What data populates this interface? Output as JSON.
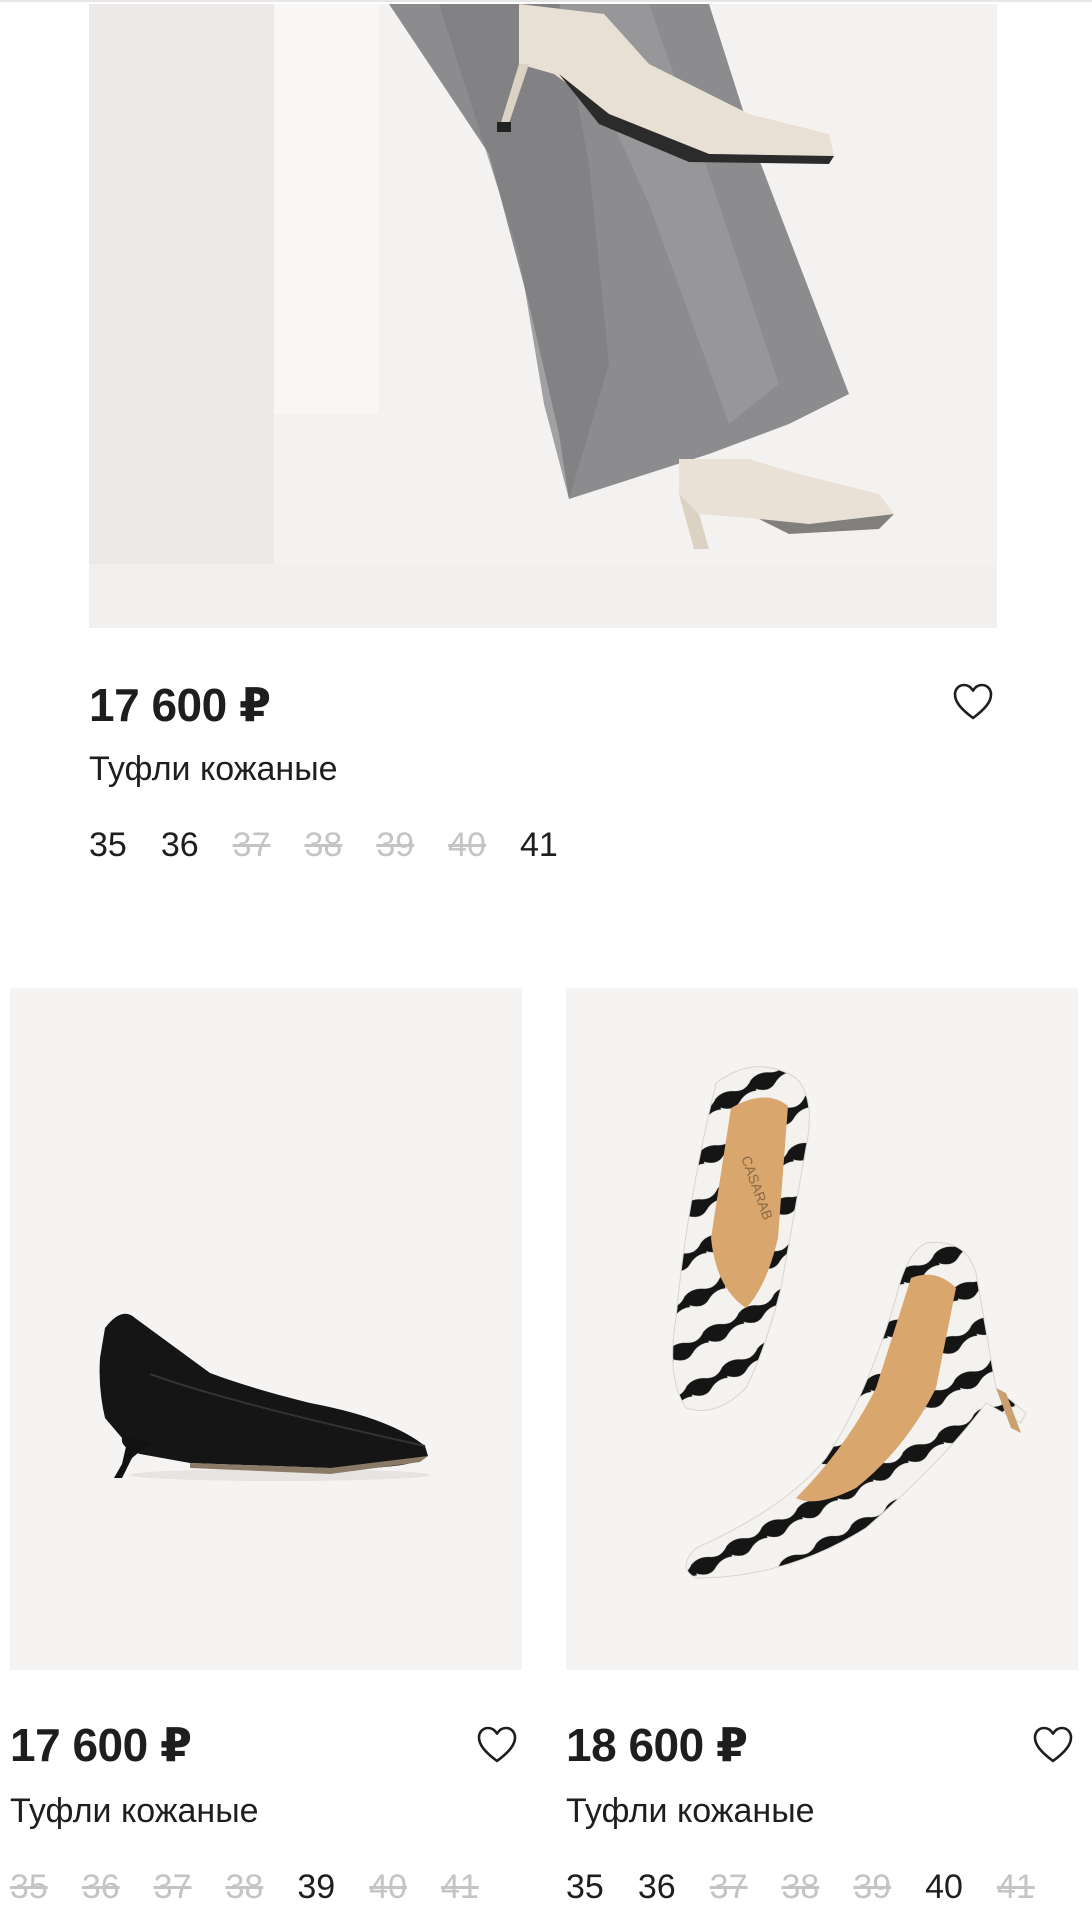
{
  "products": [
    {
      "price": "17 600 ₽",
      "title": "Туфли кожаные",
      "sizes": [
        {
          "label": "35",
          "available": true
        },
        {
          "label": "36",
          "available": true
        },
        {
          "label": "37",
          "available": false
        },
        {
          "label": "38",
          "available": false
        },
        {
          "label": "39",
          "available": false
        },
        {
          "label": "40",
          "available": false
        },
        {
          "label": "41",
          "available": true
        }
      ],
      "image": "beige-pumps-grey-trousers",
      "favorite_icon": "heart-outline-icon"
    },
    {
      "price": "17 600 ₽",
      "title": "Туфли кожаные",
      "sizes": [
        {
          "label": "35",
          "available": false
        },
        {
          "label": "36",
          "available": false
        },
        {
          "label": "37",
          "available": false
        },
        {
          "label": "38",
          "available": false
        },
        {
          "label": "39",
          "available": true
        },
        {
          "label": "40",
          "available": false
        },
        {
          "label": "41",
          "available": false
        }
      ],
      "image": "black-leather-pump",
      "favorite_icon": "heart-outline-icon"
    },
    {
      "price": "18 600 ₽",
      "title": "Туфли кожаные",
      "sizes": [
        {
          "label": "35",
          "available": true
        },
        {
          "label": "36",
          "available": true
        },
        {
          "label": "37",
          "available": false
        },
        {
          "label": "38",
          "available": false
        },
        {
          "label": "39",
          "available": false
        },
        {
          "label": "40",
          "available": true
        },
        {
          "label": "41",
          "available": false
        }
      ],
      "image": "zebra-print-pumps",
      "image_text": "CASARAB",
      "favorite_icon": "heart-outline-icon"
    }
  ],
  "colors": {
    "text": "#1e1e1e",
    "unavailable": "#c4c4c4",
    "image_bg": "#f3f1f0"
  }
}
